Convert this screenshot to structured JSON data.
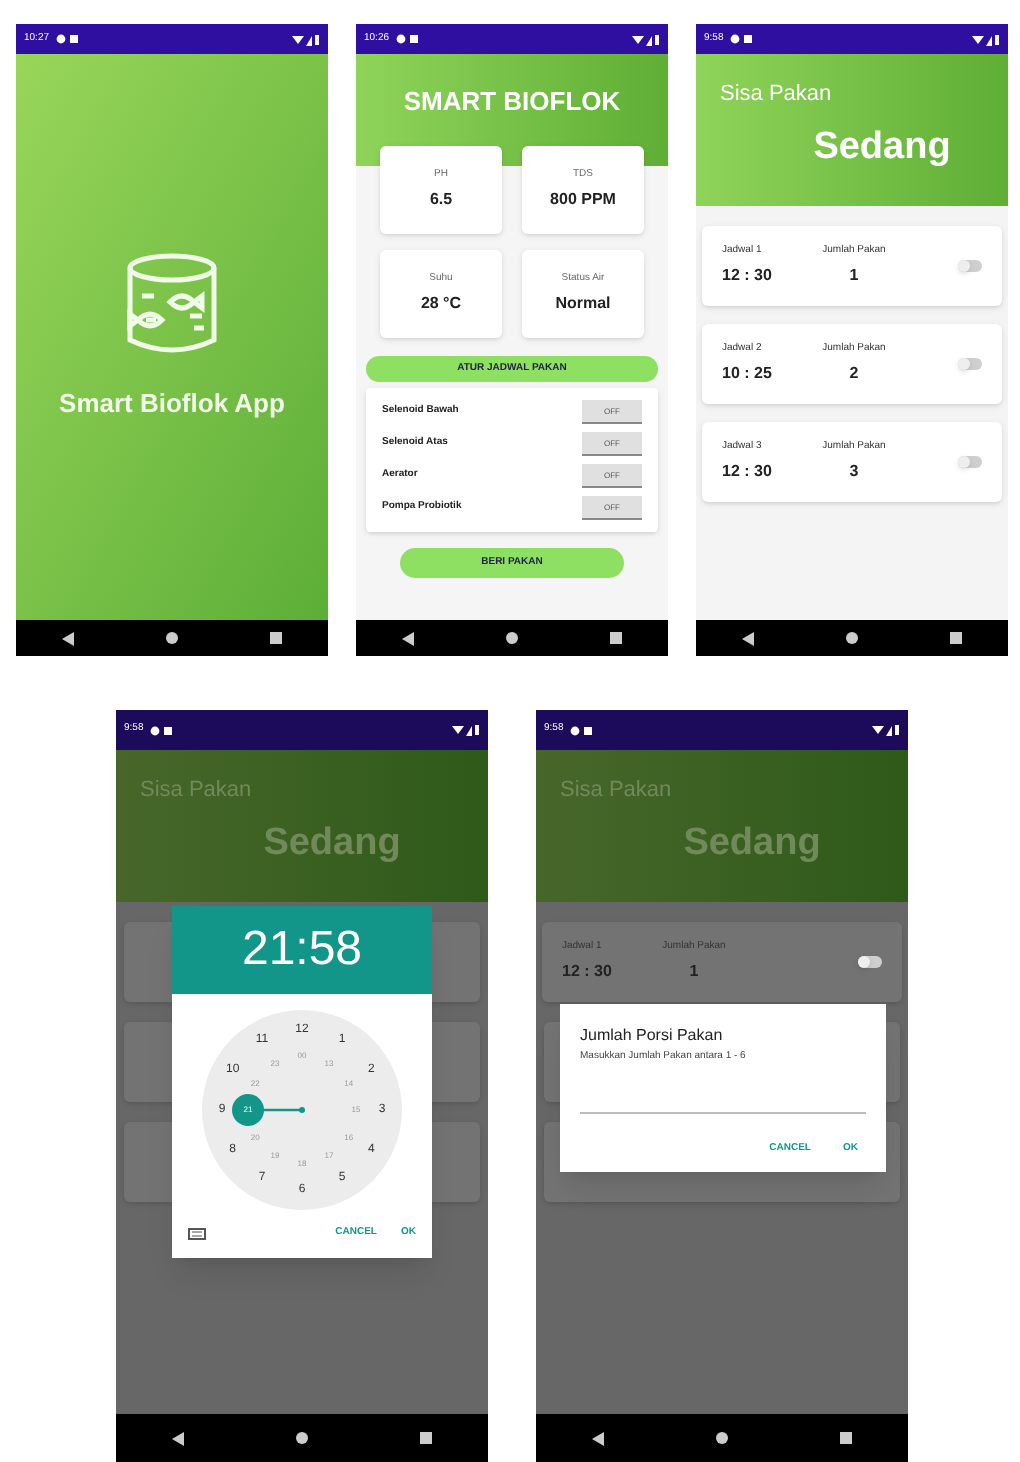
{
  "screens": [
    {
      "kind": "splash",
      "status_time": "10:27",
      "title": "Smart Bioflok App"
    },
    {
      "kind": "dashboard",
      "status_time": "10:26",
      "title": "SMART BIOFLOK",
      "sensors": [
        {
          "label": "PH",
          "value": "6.5"
        },
        {
          "label": "TDS",
          "value": "800 PPM"
        },
        {
          "label": "Suhu",
          "value": "28 °C"
        },
        {
          "label": "Status Air",
          "value": "Normal"
        }
      ],
      "schedule_button": "ATUR JADWAL PAKAN",
      "devices": [
        {
          "label": "Selenoid Bawah",
          "button": "OFF"
        },
        {
          "label": "Selenoid Atas",
          "button": "OFF"
        },
        {
          "label": "Aerator",
          "button": "OFF"
        },
        {
          "label": "Pompa Probiotik",
          "button": "OFF"
        }
      ],
      "feed_button": "BERI PAKAN"
    },
    {
      "kind": "schedule",
      "status_time": "9:58",
      "label": "Sisa Pakan",
      "status": "Sedang",
      "schedules": [
        {
          "label": "Jadwal 1",
          "time": "12 : 30",
          "amount_label": "Jumlah Pakan",
          "amount": "1",
          "on": false
        },
        {
          "label": "Jadwal 2",
          "time": "10 : 25",
          "amount_label": "Jumlah Pakan",
          "amount": "2",
          "on": false
        },
        {
          "label": "Jadwal 3",
          "time": "12 : 30",
          "amount_label": "Jumlah Pakan",
          "amount": "3",
          "on": false
        }
      ]
    },
    {
      "kind": "time_picker",
      "status_time": "9:58",
      "label": "Sisa Pakan",
      "status": "Sedang",
      "dialog": {
        "time": "21:58",
        "outer": [
          {
            "label": "12",
            "selected": false
          },
          {
            "label": "1",
            "selected": false
          },
          {
            "label": "2",
            "selected": false
          },
          {
            "label": "3",
            "selected": false
          },
          {
            "label": "4",
            "selected": false
          },
          {
            "label": "5",
            "selected": false
          },
          {
            "label": "6",
            "selected": false
          },
          {
            "label": "7",
            "selected": false
          },
          {
            "label": "8",
            "selected": false
          },
          {
            "label": "9",
            "selected": false
          },
          {
            "label": "10",
            "selected": false
          },
          {
            "label": "11",
            "selected": false
          }
        ],
        "inner": [
          {
            "label": "00",
            "selected": false
          },
          {
            "label": "13",
            "selected": false
          },
          {
            "label": "14",
            "selected": false
          },
          {
            "label": "15",
            "selected": false
          },
          {
            "label": "16",
            "selected": false
          },
          {
            "label": "17",
            "selected": false
          },
          {
            "label": "18",
            "selected": false
          },
          {
            "label": "19",
            "selected": false
          },
          {
            "label": "20",
            "selected": false
          },
          {
            "label": "21",
            "selected": true
          },
          {
            "label": "22",
            "selected": false
          },
          {
            "label": "23",
            "selected": false
          }
        ],
        "buttons": [
          "CANCEL",
          "OK"
        ]
      }
    },
    {
      "kind": "portion_dialog",
      "status_time": "9:58",
      "label": "Sisa Pakan",
      "status": "Sedang",
      "schedules": [
        {
          "label": "Jadwal 1",
          "time": "12 : 30",
          "amount_label": "Jumlah Pakan",
          "amount": "1",
          "on": false
        }
      ],
      "dialog": {
        "title": "Jumlah Porsi Pakan",
        "message": "Masukkan Jumlah Pakan antara 1 - 6",
        "buttons": [
          "CANCEL",
          "OK"
        ]
      }
    }
  ]
}
